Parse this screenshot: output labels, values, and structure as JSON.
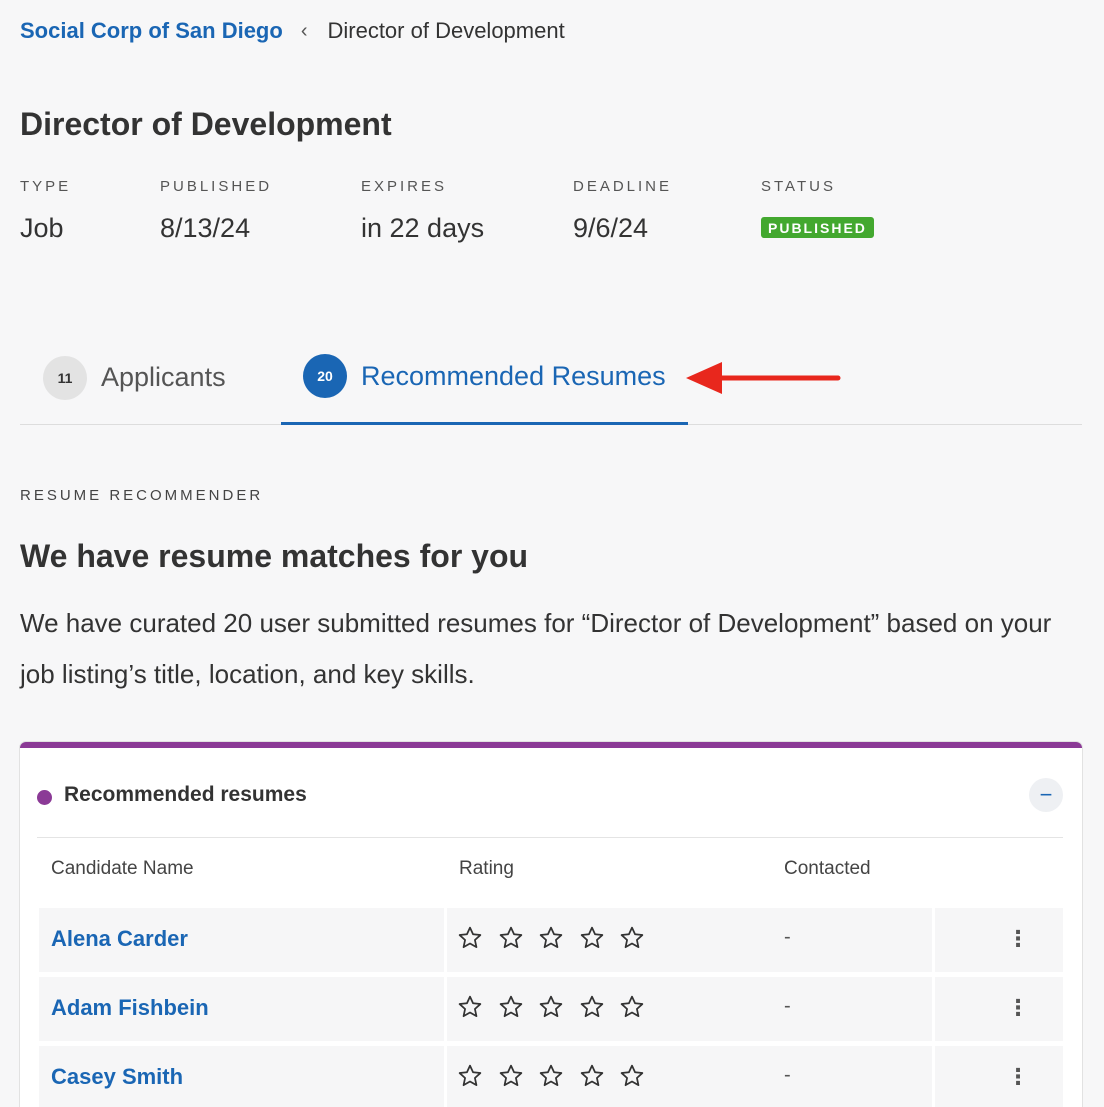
{
  "breadcrumb": {
    "org": "Social Corp of San Diego",
    "separator": "‹",
    "current": "Director of Development"
  },
  "page_title": "Director of Development",
  "meta": [
    {
      "label": "TYPE",
      "value": "Job"
    },
    {
      "label": "PUBLISHED",
      "value": "8/13/24"
    },
    {
      "label": "EXPIRES",
      "value": "in 22 days"
    },
    {
      "label": "DEADLINE",
      "value": "9/6/24"
    },
    {
      "label": "STATUS",
      "value": "PUBLISHED"
    }
  ],
  "colors": {
    "accent": "#1a66b4",
    "status_green": "#43a82f",
    "card_purple": "#8b3a96",
    "arrow_red": "#e8271d"
  },
  "tabs": [
    {
      "count": "11",
      "label": "Applicants",
      "active": false
    },
    {
      "count": "20",
      "label": "Recommended Resumes",
      "active": true
    }
  ],
  "recommender": {
    "eyebrow": "RESUME RECOMMENDER",
    "title": "We have resume matches for you",
    "description": "We have curated 20 user submitted resumes for “Director of Development” based on your job listing’s title, location, and key skills."
  },
  "card": {
    "title": "Recommended resumes",
    "collapse_label": "−",
    "columns": [
      "Candidate Name",
      "Rating",
      "Contacted"
    ],
    "rows": [
      {
        "name": "Alena Carder",
        "rating": 0,
        "contacted": "-"
      },
      {
        "name": "Adam Fishbein",
        "rating": 0,
        "contacted": "-"
      },
      {
        "name": "Casey Smith",
        "rating": 0,
        "contacted": "-"
      }
    ],
    "kebab": "⋮",
    "max_rating": 5
  }
}
